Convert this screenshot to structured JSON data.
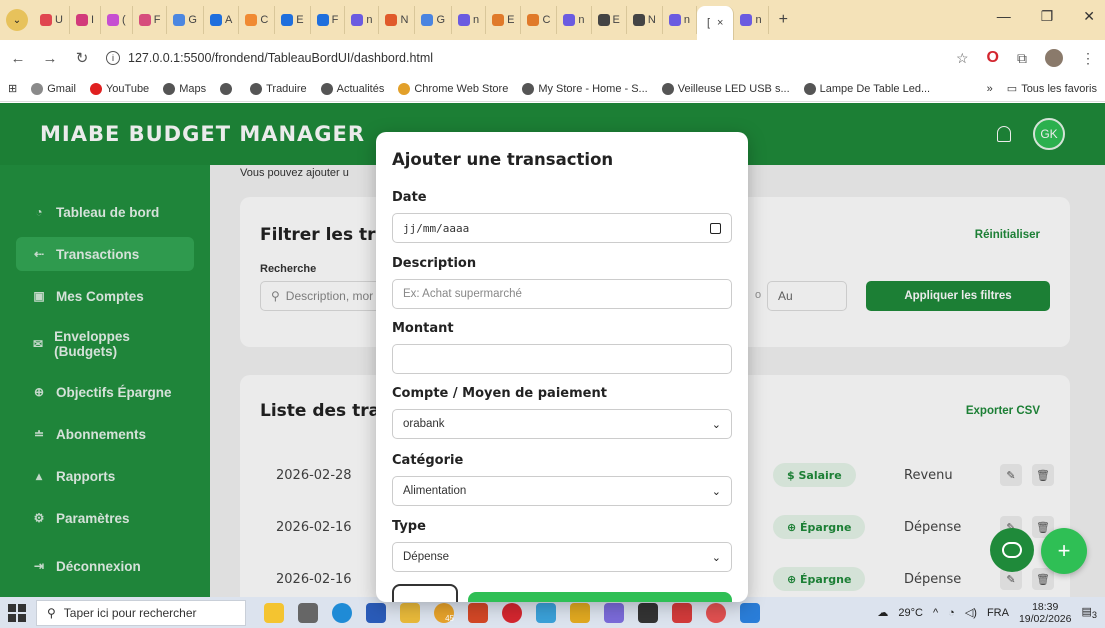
{
  "browser": {
    "tabs": [
      {
        "label": "U",
        "color": "#e0464f"
      },
      {
        "label": "I",
        "color": "#d23a7a"
      },
      {
        "label": "(",
        "color": "#c64fd1"
      },
      {
        "label": "F",
        "color": "#d64d7c"
      },
      {
        "label": "G",
        "color": "#4c87e0"
      },
      {
        "label": "A",
        "color": "#1f6fdd"
      },
      {
        "label": "C",
        "color": "#f08a32"
      },
      {
        "label": "E",
        "color": "#1f6fdd"
      },
      {
        "label": "F",
        "color": "#1f6fdd"
      },
      {
        "label": "n",
        "color": "#6b5be0"
      },
      {
        "label": "N",
        "color": "#e05a2a"
      },
      {
        "label": "G",
        "color": "#4a84e0"
      },
      {
        "label": "n",
        "color": "#6b5be0"
      },
      {
        "label": "E",
        "color": "#e07a2a"
      },
      {
        "label": "C",
        "color": "#e07a2a"
      },
      {
        "label": "n",
        "color": "#6b5be0"
      },
      {
        "label": "E",
        "color": "#444444"
      },
      {
        "label": "N",
        "color": "#444444"
      },
      {
        "label": "n",
        "color": "#6b5be0"
      }
    ],
    "active_tab": {
      "label": "[",
      "close": "×"
    },
    "trailing_tab": {
      "label": "n"
    },
    "new_tab": "+",
    "url": "127.0.0.1:5500/frondend/TableauBordUI/dashbord.html",
    "bookmarks": [
      {
        "label": "Gmail",
        "color": "#8a8a8a"
      },
      {
        "label": "YouTube",
        "color": "#e02020"
      },
      {
        "label": "Maps",
        "color": "#555555"
      },
      {
        "label": "",
        "color": "#555555"
      },
      {
        "label": "Traduire",
        "color": "#555555"
      },
      {
        "label": "Actualités",
        "color": "#555555"
      },
      {
        "label": "Chrome Web Store",
        "color": "#e2a02a"
      },
      {
        "label": "My Store - Home - S...",
        "color": "#555555"
      },
      {
        "label": "Veilleuse LED USB s...",
        "color": "#555555"
      },
      {
        "label": "Lampe De Table Led...",
        "color": "#555555"
      }
    ],
    "bookmarks_more": "»",
    "all_bookmarks": "Tous les favoris"
  },
  "app": {
    "brand": "MIABE BUDGET MANAGER",
    "avatar_initials": "GK",
    "colors": {
      "primary": "#1f8a3a",
      "sidebar": "#22913f",
      "accent": "#2fbf55"
    },
    "subtitle_peek": "Vous pouvez ajouter u",
    "sidebar": [
      {
        "label": "Tableau de bord",
        "icon": "dashboard-icon"
      },
      {
        "label": "Transactions",
        "icon": "transactions-icon"
      },
      {
        "label": "Mes Comptes",
        "icon": "wallet-icon"
      },
      {
        "label": "Enveloppes (Budgets)",
        "icon": "envelope-icon"
      },
      {
        "label": "Objectifs Épargne",
        "icon": "target-icon"
      },
      {
        "label": "Abonnements",
        "icon": "subscriptions-icon"
      },
      {
        "label": "Rapports",
        "icon": "chart-icon"
      },
      {
        "label": "Paramètres",
        "icon": "gear-icon"
      }
    ],
    "logout": "Déconnexion",
    "filter": {
      "title": "Filtrer les tran",
      "reset": "Réinitialiser",
      "search_label": "Recherche",
      "search_placeholder": "Description, mor",
      "date_sep": "o",
      "date_to": "Au",
      "apply": "Appliquer les filtres"
    },
    "list": {
      "title": "Liste des tran",
      "export": "Exporter CSV",
      "rows": [
        {
          "date": "2026-02-28",
          "category": "$ Salaire",
          "type": "Revenu"
        },
        {
          "date": "2026-02-16",
          "category": "⊕ Épargne",
          "type": "Dépense"
        },
        {
          "date": "2026-02-16",
          "category": "⊕ Épargne",
          "type": "Dépense"
        }
      ]
    }
  },
  "modal": {
    "title": "Ajouter une transaction",
    "date_label": "Date",
    "date_placeholder": "jj/mm/aaaa",
    "description_label": "Description",
    "description_placeholder": "Ex: Achat supermarché",
    "amount_label": "Montant",
    "amount_value": "",
    "account_label": "Compte / Moyen de paiement",
    "account_value": "orabank",
    "category_label": "Catégorie",
    "category_value": "Alimentation",
    "type_label": "Type",
    "type_value": "Dépense"
  },
  "taskbar": {
    "search_placeholder": "Taper ici pour rechercher",
    "badge": "45",
    "weather": "29°C",
    "lang": "FRA",
    "time": "18:39",
    "date": "19/02/2026",
    "notif_count": "3"
  }
}
